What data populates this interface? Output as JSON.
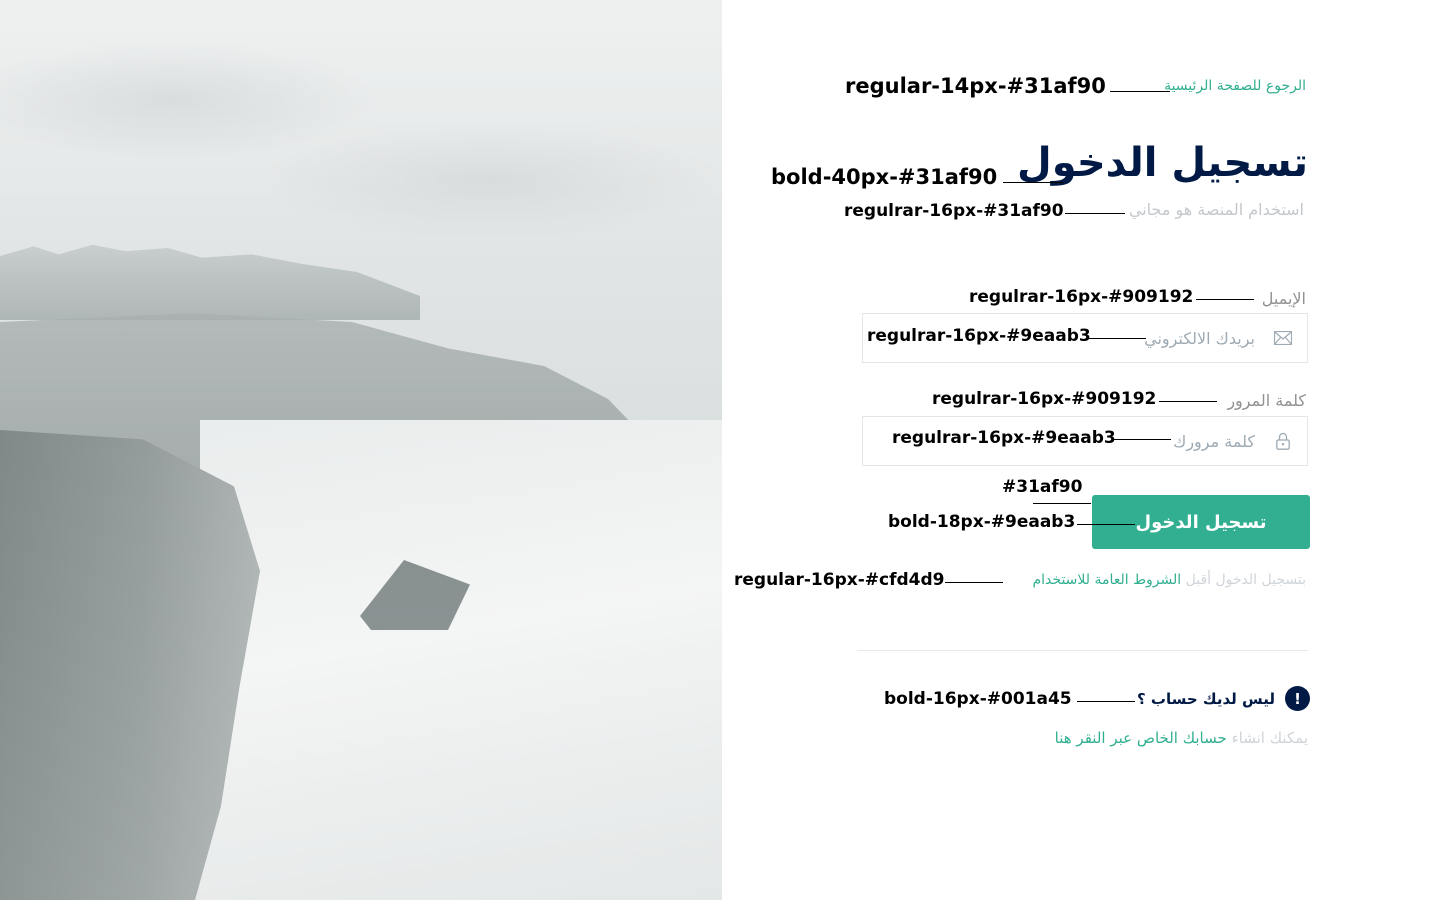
{
  "back_link": {
    "label": "الرجوع للصفحة الرئيسية"
  },
  "header": {
    "title": "تسجيل الدخول",
    "subtitle": "استخدام المنصة هو مجاني"
  },
  "form": {
    "email": {
      "label": "الإيميل",
      "placeholder": "بريدك الالكتروني",
      "icon": "envelope-icon",
      "value": ""
    },
    "password": {
      "label": "كلمة المرور",
      "placeholder": "كلمة مرورك",
      "icon": "lock-icon",
      "value": ""
    },
    "submit_label": "تسجيل الدخول"
  },
  "terms": {
    "prefix": "بتسجيل الدخول أقبل",
    "link": "الشروط العامة للاستخدام"
  },
  "signup": {
    "question": "ليس لديك حساب ؟",
    "badge": "!",
    "prefix": "يمكنك انشاء",
    "link": "حسابك الخاص عبر النقر هنا"
  },
  "annotations": {
    "back_link": "regular-14px-#31af90",
    "title": "bold-40px-#31af90",
    "subtitle": "regulrar-16px-#31af90",
    "email_label": "regulrar-16px-#909192",
    "email_placeholder": "regulrar-16px-#9eaab3",
    "password_label": "regulrar-16px-#909192",
    "password_placeholder": "regulrar-16px-#9eaab3",
    "button_color": "#31af90",
    "button_text": "bold-18px-#9eaab3",
    "terms": "regular-16px-#cfd4d9",
    "signup_question": "bold-16px-#001a45"
  },
  "colors": {
    "accent": "#31af90",
    "navy": "#001a45",
    "label_gray": "#909192",
    "placeholder_gray": "#9eaab3",
    "muted": "#cfd4d9"
  }
}
